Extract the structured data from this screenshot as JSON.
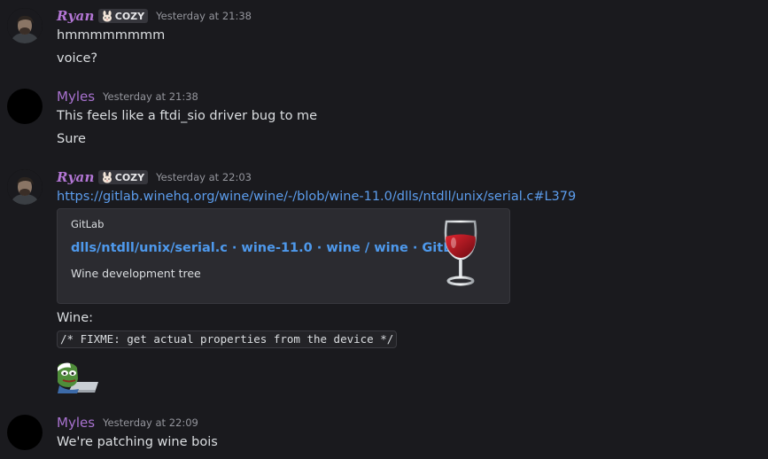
{
  "messages": [
    {
      "author": "Ryan",
      "tag": "COZY",
      "timestamp": "Yesterday at 21:38",
      "lines": [
        "hmmmmmmmm",
        "voice?"
      ]
    },
    {
      "author": "Myles",
      "timestamp": "Yesterday at 21:38",
      "lines": [
        "This feels like a ftdi_sio driver bug to me",
        "Sure"
      ]
    },
    {
      "author": "Ryan",
      "tag": "COZY",
      "timestamp": "Yesterday at 22:03",
      "link": "https://gitlab.winehq.org/wine/wine/-/blob/wine-11.0/dlls/ntdll/unix/serial.c#L379",
      "embed": {
        "provider": "GitLab",
        "title": "dlls/ntdll/unix/serial.c · wine-11.0 · wine / wine · GitLab",
        "description": "Wine development tree",
        "thumbnail_icon": "wine-glass-icon"
      },
      "text": "Wine:",
      "code": "/* FIXME: get actual properties from the device */",
      "sticker_icon": "pepe-laptop-emoji"
    },
    {
      "author": "Myles",
      "timestamp": "Yesterday at 22:09",
      "lines": [
        "We're patching wine bois"
      ]
    }
  ],
  "colors": {
    "background": "#1a1a1e",
    "ryan_name": "#b477d6",
    "myles_name": "#a872cf",
    "link": "#5c9ded",
    "embed_bg": "#2b2b30"
  }
}
